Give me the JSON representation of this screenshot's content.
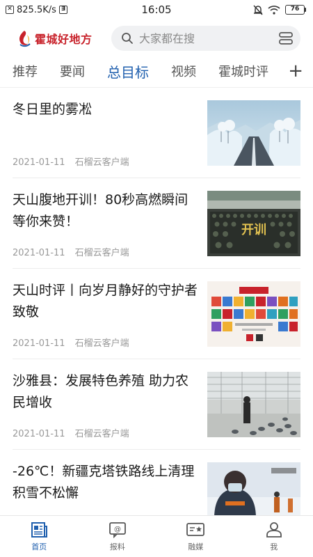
{
  "status_bar": {
    "net_speed": "825.5K/s",
    "time": "16:05",
    "battery": "76"
  },
  "header": {
    "logo_text": "霍城好地方",
    "search_placeholder": "大家都在搜"
  },
  "tabs": [
    {
      "label": "推荐",
      "active": false
    },
    {
      "label": "要闻",
      "active": false
    },
    {
      "label": "总目标",
      "active": true
    },
    {
      "label": "视频",
      "active": false
    },
    {
      "label": "霍城时评",
      "active": false
    }
  ],
  "feed": [
    {
      "title": "冬日里的雾凇",
      "date": "2021-01-11",
      "source": "石榴云客户端",
      "thumb": "snowy-road-rime"
    },
    {
      "title": "天山腹地开训！80秒高燃瞬间等你来赞！",
      "date": "2021-01-11",
      "source": "石榴云客户端",
      "thumb": "military-training",
      "thumb_text": "开训"
    },
    {
      "title": "天山时评丨向岁月静好的守护者致敬",
      "date": "2021-01-11",
      "source": "石榴云客户端",
      "thumb": "police-day-poster"
    },
    {
      "title": "沙雅县：发展特色养殖 助力农民增收",
      "date": "2021-01-11",
      "source": "石榴云客户端",
      "thumb": "pigeon-farm"
    },
    {
      "title": "-26℃！新疆克塔铁路线上清理积雪不松懈",
      "date": "",
      "source": "",
      "thumb": "railway-worker-winter"
    }
  ],
  "bottom_nav": [
    {
      "label": "首页",
      "icon": "news-icon",
      "active": true
    },
    {
      "label": "报料",
      "icon": "report-icon",
      "active": false
    },
    {
      "label": "融媒",
      "icon": "media-icon",
      "active": false
    },
    {
      "label": "我",
      "icon": "user-icon",
      "active": false
    }
  ],
  "colors": {
    "accent": "#1f5fae",
    "brand": "#c8222b",
    "meta_text": "#999999"
  }
}
